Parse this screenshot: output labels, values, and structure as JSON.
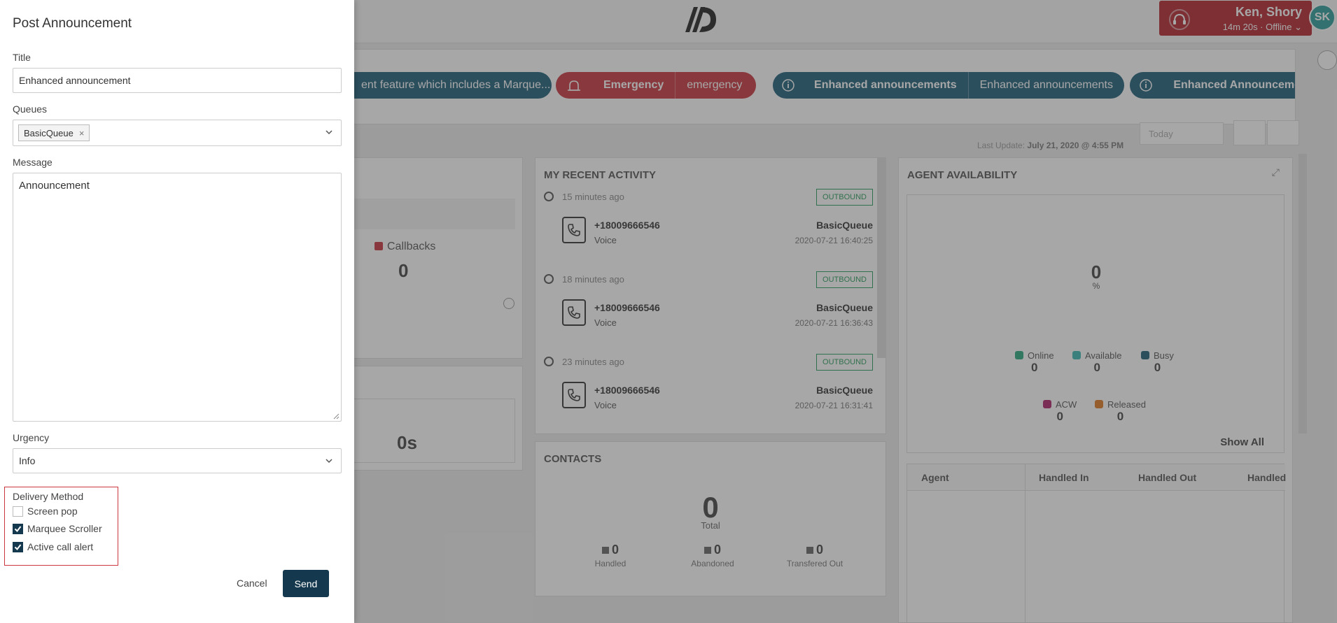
{
  "header": {
    "user_name": "Ken, Shory",
    "user_status": "14m 20s · Offline",
    "avatar_initials": "SK"
  },
  "marquee": {
    "items": [
      {
        "text": "ent feature which includes a Marque..."
      },
      {
        "title": "Emergency",
        "text": "emergency"
      },
      {
        "title": "Enhanced announcements",
        "text": "Enhanced announcements"
      },
      {
        "title": "Enhanced Announceme"
      }
    ]
  },
  "toolbar": {
    "last_update_label": "Last Update:",
    "last_update_value": "July 21, 2020 @ 4:55 PM",
    "range": "Today"
  },
  "summary": {
    "callbacks_label": "Callbacks",
    "callbacks_value": "0",
    "duration_value": "0s"
  },
  "recent_activity": {
    "title": "MY RECENT ACTIVITY",
    "items": [
      {
        "ago": "15 minutes ago",
        "badge": "OUTBOUND",
        "number": "+18009666546",
        "type": "Voice",
        "queue": "BasicQueue",
        "date": "2020-07-21 16:40:25"
      },
      {
        "ago": "18 minutes ago",
        "badge": "OUTBOUND",
        "number": "+18009666546",
        "type": "Voice",
        "queue": "BasicQueue",
        "date": "2020-07-21 16:36:43"
      },
      {
        "ago": "23 minutes ago",
        "badge": "OUTBOUND",
        "number": "+18009666546",
        "type": "Voice",
        "queue": "BasicQueue",
        "date": "2020-07-21 16:31:41"
      }
    ]
  },
  "contacts": {
    "title": "CONTACTS",
    "total": "0",
    "total_label": "Total",
    "stats": [
      {
        "value": "0",
        "label": "Handled"
      },
      {
        "value": "0",
        "label": "Abandoned"
      },
      {
        "value": "0",
        "label": "Transfered Out"
      }
    ]
  },
  "agent_availability": {
    "title": "AGENT AVAILABILITY",
    "percent": "0",
    "percent_sign": "%",
    "legend": [
      {
        "label": "Online",
        "value": "0",
        "color": "#2aa87c"
      },
      {
        "label": "Available",
        "value": "0",
        "color": "#3bb9b3"
      },
      {
        "label": "Busy",
        "value": "0",
        "color": "#1f5f7a"
      },
      {
        "label": "ACW",
        "value": "0",
        "color": "#b0246a"
      },
      {
        "label": "Released",
        "value": "0",
        "color": "#e07a1f"
      }
    ],
    "show_all": "Show All",
    "columns": [
      "Agent",
      "Handled In",
      "Handled Out",
      "Handled"
    ]
  },
  "announcement_form": {
    "title": "Post Announcement",
    "title_label": "Title",
    "title_value": "Enhanced announcement",
    "queues_label": "Queues",
    "queue_chip": "BasicQueue",
    "message_label": "Message",
    "message_value": "Announcement",
    "urgency_label": "Urgency",
    "urgency_value": "Info",
    "delivery_label": "Delivery Method",
    "delivery_options": [
      {
        "label": "Screen pop",
        "checked": false
      },
      {
        "label": "Marquee Scroller",
        "checked": true
      },
      {
        "label": "Active call alert",
        "checked": true
      }
    ],
    "cancel": "Cancel",
    "send": "Send"
  },
  "colors": {
    "brand_dark": "#14384d",
    "alert_red": "#c9373f",
    "teal": "#1f5f7a"
  }
}
